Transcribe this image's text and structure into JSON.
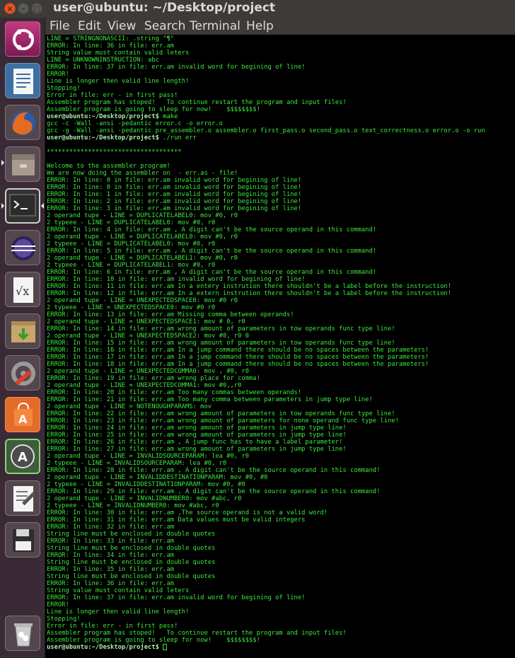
{
  "window": {
    "title": "user@ubuntu: ~/Desktop/project",
    "buttons": {
      "close": "×",
      "minimize": "–",
      "maximize": "□"
    }
  },
  "menu": [
    "File",
    "Edit",
    "View",
    "Search",
    "Terminal",
    "Help"
  ],
  "launcher": [
    {
      "name": "ubuntu-dash-icon"
    },
    {
      "name": "libreoffice-writer-icon"
    },
    {
      "name": "firefox-icon"
    },
    {
      "name": "files-icon"
    },
    {
      "name": "terminal-icon"
    },
    {
      "name": "eclipse-icon"
    },
    {
      "name": "libreoffice-math-icon"
    },
    {
      "name": "archive-manager-icon"
    },
    {
      "name": "system-settings-icon"
    },
    {
      "name": "software-center-icon"
    },
    {
      "name": "software-updater-icon"
    },
    {
      "name": "text-editor-icon"
    },
    {
      "name": "save-disk-icon"
    },
    {
      "name": "trash-icon"
    }
  ],
  "terminal": {
    "lines": [
      {
        "t": "LINE = STRINGNONASCII: .string \"¶\""
      },
      {
        "t": "ERROR: In line: 36 in file: err.am"
      },
      {
        "t": "String value must contain valid leters"
      },
      {
        "t": "LINE = UNKNOWNINSTRUCTION: abc"
      },
      {
        "t": "ERROR: In line: 37 in file: err.am invalid word for begining of line!"
      },
      {
        "t": "ERROR!"
      },
      {
        "t": "Line is longer then valid line length!"
      },
      {
        "t": "Stopping!"
      },
      {
        "t": "Error in file: err - in first pass!"
      },
      {
        "t": "Assembler program has stoped!   To continue restart the program and input files!"
      },
      {
        "t": "Assembler program is going to sleep for now!    $$$$$$$$!"
      },
      {
        "p": "user@ubuntu:~/Desktop/project$",
        "t": " make"
      },
      {
        "t": "gcc -c -Wall -ansi -pedantic error.c -o error.o"
      },
      {
        "t": "gcc -g -Wall -ansi -pedantic pre_assembler.o assembler.o first_pass.o second_pass.o text_correctness.o error.o -o run"
      },
      {
        "p": "user@ubuntu:~/Desktop/project$",
        "t": " ./run err"
      },
      {
        "t": ""
      },
      {
        "t": "************************************"
      },
      {
        "t": ""
      },
      {
        "t": "Welcome to the assembler program!"
      },
      {
        "t": "We are now doing the assembler on  - err.as - file!"
      },
      {
        "t": "ERROR: In line: 0 in file: err.am invalid word for begining of line!"
      },
      {
        "t": "ERROR: In line: 0 in file: err.am invalid word for begining of line!"
      },
      {
        "t": "ERROR: In line: 1 in file: err.am invalid word for begining of line!"
      },
      {
        "t": "ERROR: In line: 2 in file: err.am invalid word for begining of line!"
      },
      {
        "t": "ERROR: In line: 3 in file: err.am invalid word for begining of line!"
      },
      {
        "t": "2 operand tupe - LINE = DUPLICATELABEL0: mov #0, r0"
      },
      {
        "t": "2 typeee - LINE = DUPLICATELABEL0: mov #0, r0"
      },
      {
        "t": "ERROR: In line: 4 in file: err.am , A digit can't be the source operand in this command!"
      },
      {
        "t": "2 operand tupe - LINE = DUPLICATELABEL0: mov #0, r0"
      },
      {
        "t": "2 typeee - LINE = DUPLICATELABEL0: mov #0, r0"
      },
      {
        "t": "ERROR: In line: 5 in file: err.am , A digit can't be the source operand in this command!"
      },
      {
        "t": "2 operand tupe - LINE = DUPLICATELABEL1: mov #0, r0"
      },
      {
        "t": "2 typeee - LINE = DUPLICATELABEL1: mov #0, r0"
      },
      {
        "t": "ERROR: In line: 6 in file: err.am , A digit can't be the source operand in this command!"
      },
      {
        "t": "ERROR: In line: 10 in file: err.am invalid word for begining of line!"
      },
      {
        "t": "ERROR: In line: 11 in file: err.am In a entery instrution there shouldn't be a label before the instruction!"
      },
      {
        "t": "ERROR: In line: 12 in file: err.am In a extern instrution there shouldn't be a label before the instruction!"
      },
      {
        "t": "2 operand tupe - LINE = UNEXPECTEDSPACE0: mov #0 r0"
      },
      {
        "t": "2 typeee - LINE = UNEXPECTEDSPACE0: mov #0 r0"
      },
      {
        "t": "ERROR: In line: 13 in file: err.am Missing comma between operands!"
      },
      {
        "t": "2 operand tupe - LINE = UNEXPECTEDSPACE1: mov # 0, r0"
      },
      {
        "t": "ERROR: In line: 14 in file: err.am wrong amount of parameters in tow operands func type line!"
      },
      {
        "t": "2 operand tupe - LINE = UNEXPECTEDSPACE2: mov #0, r0 0"
      },
      {
        "t": "ERROR: In line: 15 in file: err.am wrong amount of parameters in tow operands func type line!"
      },
      {
        "t": "ERROR: In line: 16 in file: err.am In a jump command there should be no spaces between the parameters!"
      },
      {
        "t": "ERROR: In line: 17 in file: err.am In a jump command there should be no spaces between the parameters!"
      },
      {
        "t": "ERROR: In line: 18 in file: err.am In a jump command there should be no spaces between the parameters!"
      },
      {
        "t": "2 operand tupe - LINE = UNEXPECTEDCOMMA0: mov , #0, r0"
      },
      {
        "t": "ERROR: In line: 19 in file: err.am wrong place for comma!"
      },
      {
        "t": "2 operand tupe - LINE = UNEXPECTEDCOMMA1: mov #0,,r0"
      },
      {
        "t": "ERROR: In line: 20 in file: err.am Too many commas between operands!"
      },
      {
        "t": "ERROR: In line: 21 in file: err.am Too many comma between parameters in jump type line!"
      },
      {
        "t": "2 operand tupe - LINE = NOTENOUGHPARAMS: mov"
      },
      {
        "t": "ERROR: In line: 22 in file: err.am wrong amount of parameters in tow operands func type line!"
      },
      {
        "t": "ERROR: In line: 23 in file: err.am wrong amount of parameters for none operand func type line!"
      },
      {
        "t": "ERROR: In line: 24 in file: err.am wrong amount of parameters in jump type line!"
      },
      {
        "t": "ERROR: In line: 25 in file: err.am wrong amount of parameters in jump type line!"
      },
      {
        "t": "ERROR: In line: 26 in file: err.am , A jump func has to have a label parameter!"
      },
      {
        "t": "ERROR: In line: 27 in file: err.am wrong amount of parameters in jump type line!"
      },
      {
        "t": "2 operand tupe - LINE = INVALIDSOURCEPARAM: lea #0, r0"
      },
      {
        "t": "2 typeee - LINE = INVALIDSOURCEPARAM: lea #0, r0"
      },
      {
        "t": "ERROR: In line: 28 in file: err.am , A digit can't be the source operand in this command!"
      },
      {
        "t": "2 operand tupe - LINE = INVALIDDESTINATIONPARAM: mov #0, #0"
      },
      {
        "t": "2 typeee - LINE = INVALIDDESTINATIONPARAM: mov #0, #0"
      },
      {
        "t": "ERROR: In line: 29 in file: err.am , A digit can't be the source operand in this command!"
      },
      {
        "t": "2 operand tupe - LINE = INVALIDNUMBER0: mov #abc, r0"
      },
      {
        "t": "2 typeee - LINE = INVALIDNUMBER0: mov #abc, r0"
      },
      {
        "t": "ERROR: In line: 30 in file: err.am ,The source operand is not a valid word!"
      },
      {
        "t": "ERROR: In line: 31 in file: err.am Data values must be valid integers"
      },
      {
        "t": "ERROR: In line: 32 in file: err.am"
      },
      {
        "t": "String line must be enclosed in double quotes"
      },
      {
        "t": "ERROR: In line: 33 in file: err.am"
      },
      {
        "t": "String line must be enclosed in double quotes"
      },
      {
        "t": "ERROR: In line: 34 in file: err.am"
      },
      {
        "t": "String line must be enclosed in double quotes"
      },
      {
        "t": "ERROR: In line: 35 in file: err.am"
      },
      {
        "t": "String line must be enclosed in double quotes"
      },
      {
        "t": "ERROR: In line: 36 in file: err.am"
      },
      {
        "t": "String value must contain valid leters"
      },
      {
        "t": "ERROR: In line: 37 in file: err.am invalid word for begining of line!"
      },
      {
        "t": "ERROR!"
      },
      {
        "t": "Line is longer then valid line length!"
      },
      {
        "t": "Stopping!"
      },
      {
        "t": "Error in file: err - in first pass!"
      },
      {
        "t": "Assembler program has stoped!   To continue restart the program and input files!"
      },
      {
        "t": "Assembler program is going to sleep for now!    $$$$$$$$!"
      },
      {
        "p": "user@ubuntu:~/Desktop/project$",
        "t": " ",
        "cursor": true
      }
    ]
  }
}
